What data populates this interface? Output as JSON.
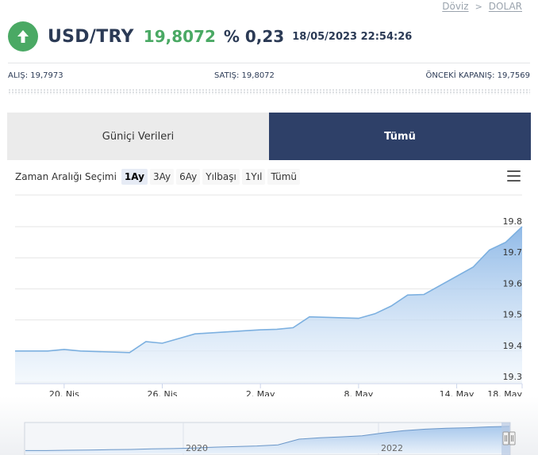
{
  "breadcrumb": {
    "items": [
      "Döviz",
      "DOLAR"
    ]
  },
  "quote": {
    "symbol": "USD/TRY",
    "price": "19,8072",
    "change": "% 0,23",
    "timestamp": "18/05/2023 22:54:26",
    "direction_icon": "arrow-up-icon",
    "up_color": "#4aa964"
  },
  "stats": {
    "bid": "ALIŞ: 19,7973",
    "ask": "SATIŞ: 19,8072",
    "prev_close": "ÖNCEKİ KAPANIŞ: 19,7569"
  },
  "tabs": [
    {
      "label": "Güniçi Verileri",
      "active": false
    },
    {
      "label": "Tümü",
      "active": true
    }
  ],
  "range": {
    "label": "Zaman Aralığı Seçimi",
    "buttons": [
      "1Ay",
      "3Ay",
      "6Ay",
      "Yılbaşı",
      "1Yıl",
      "Tümü"
    ],
    "selected": "1Ay"
  },
  "menu_icon": "hamburger-icon",
  "chart_data": {
    "type": "area",
    "x": [
      "2023-04-17",
      "2023-04-18",
      "2023-04-19",
      "2023-04-20",
      "2023-04-21",
      "2023-04-24",
      "2023-04-25",
      "2023-04-26",
      "2023-04-27",
      "2023-04-28",
      "2023-05-01",
      "2023-05-02",
      "2023-05-03",
      "2023-05-04",
      "2023-05-05",
      "2023-05-08",
      "2023-05-09",
      "2023-05-10",
      "2023-05-11",
      "2023-05-12",
      "2023-05-15",
      "2023-05-16",
      "2023-05-17",
      "2023-05-18"
    ],
    "values": [
      19.4,
      19.4,
      19.4,
      19.405,
      19.4,
      19.395,
      19.43,
      19.425,
      19.44,
      19.455,
      19.465,
      19.468,
      19.47,
      19.475,
      19.51,
      19.505,
      19.52,
      19.545,
      19.58,
      19.582,
      19.67,
      19.725,
      19.75,
      19.8
    ],
    "x_ticks": [
      "20. Nis",
      "26. Nis",
      "2. May",
      "8. May",
      "14. May",
      "18. May"
    ],
    "x_tick_dates": [
      "2023-04-20",
      "2023-04-26",
      "2023-05-02",
      "2023-05-08",
      "2023-05-14",
      "2023-05-18"
    ],
    "y_ticks": [
      "19.3",
      "19.4",
      "19.5",
      "19.6",
      "19.7",
      "19.8"
    ],
    "ylim": [
      19.3,
      19.8
    ],
    "y_axis_side": "right",
    "grid": true,
    "line_color": "#7cb0e0",
    "fill_color_top": "#8ab6e6",
    "fill_color_bottom": "#eef5fc",
    "navigator": {
      "labels": [
        "2020",
        "2022"
      ],
      "values": [
        0.1,
        0.1,
        0.11,
        0.12,
        0.13,
        0.14,
        0.16,
        0.17,
        0.19,
        0.22,
        0.24,
        0.26,
        0.3,
        0.5,
        0.55,
        0.58,
        0.62,
        0.72,
        0.8,
        0.85,
        0.88,
        0.9,
        0.93,
        0.95
      ]
    }
  }
}
